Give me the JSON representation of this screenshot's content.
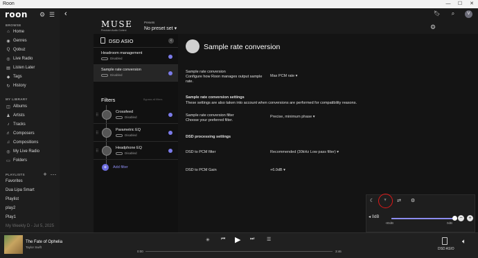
{
  "window": {
    "title": "Roon",
    "minimize": "—",
    "maximize": "☐",
    "close": "✕"
  },
  "sidebar": {
    "logo": "roon",
    "browse_header": "BROWSE",
    "browse": [
      {
        "label": "Home",
        "icon": "home-icon",
        "glyph": "⌂"
      },
      {
        "label": "Genres",
        "icon": "genres-icon",
        "glyph": "◉"
      },
      {
        "label": "Qobuz",
        "icon": "qobuz-icon",
        "glyph": "Q"
      },
      {
        "label": "Live Radio",
        "icon": "radio-icon",
        "glyph": "◎"
      },
      {
        "label": "Listen Later",
        "icon": "listen-later-icon",
        "glyph": "▤"
      },
      {
        "label": "Tags",
        "icon": "tag-icon",
        "glyph": "◆"
      },
      {
        "label": "History",
        "icon": "history-icon",
        "glyph": "↻"
      }
    ],
    "library_header": "MY LIBRARY",
    "library": [
      {
        "label": "Albums",
        "icon": "albums-icon",
        "glyph": "◫"
      },
      {
        "label": "Artists",
        "icon": "artists-icon",
        "glyph": "♟"
      },
      {
        "label": "Tracks",
        "icon": "tracks-icon",
        "glyph": "♪"
      },
      {
        "label": "Composers",
        "icon": "composers-icon",
        "glyph": "♬"
      },
      {
        "label": "Compositions",
        "icon": "compositions-icon",
        "glyph": "♫"
      },
      {
        "label": "My Live Radio",
        "icon": "my-live-radio-icon",
        "glyph": "◎"
      },
      {
        "label": "Folders",
        "icon": "folders-icon",
        "glyph": "▭"
      }
    ],
    "playlists_header": "PLAYLISTS",
    "playlists": [
      "Favorites",
      "Dua Lipa Smart",
      "Playlist",
      "play2",
      "Play1",
      "My Weekly D - Jul 5, 2025"
    ]
  },
  "header": {
    "brand": "MUSE",
    "brand_sub": "Precision Audio Control",
    "presets_label": "Presets",
    "presets_value": "No preset set"
  },
  "left_panel": {
    "device": "DSD ASIO",
    "items": [
      {
        "name": "Headroom management",
        "state": "Disabled"
      },
      {
        "name": "Sample rate conversion",
        "state": "Disabled"
      }
    ],
    "filters_title": "Filters",
    "bypass_label": "Bypass all filters",
    "filters": [
      {
        "name": "Crossfeed",
        "state": "Disabled"
      },
      {
        "name": "Parametric EQ",
        "state": "Disabled"
      },
      {
        "name": "Headphone EQ",
        "state": "Disabled"
      }
    ],
    "add_filter": "Add filter"
  },
  "right_panel": {
    "title": "Sample rate conversion",
    "src_title": "Sample rate conversion",
    "src_desc": "Configure how Roon manages output sample rate.",
    "src_value": "Max PCM rate",
    "settings_title": "Sample rate conversion settings",
    "settings_desc": "These settings are also taken into account when conversions are performed for compatibility reasons.",
    "filter_title": "Sample rate conversion filter",
    "filter_desc": "Choose your preferred filter.",
    "filter_value": "Precise, minimum phase",
    "dsd_title": "DSD processing settings",
    "dsd_pcm_filter_label": "DSD to PCM filter",
    "dsd_pcm_filter_value": "Recommended (30kHz Low pass filter)",
    "dsd_gain_label": "DSD to PCM Gain",
    "dsd_gain_value": "+6.0dB"
  },
  "volume_popup": {
    "level": "0dB",
    "min": "-80dB",
    "max": "0dB",
    "fraction": 1.0
  },
  "player": {
    "song": "The Fate of Ophelia",
    "artist": "Taylor Swift",
    "elapsed": "0:00",
    "duration": "3:46",
    "progress": 0.0,
    "zone": "DSD ASIO"
  },
  "colors": {
    "accent": "#8c8cf0",
    "highlight_ring": "#e01818"
  }
}
